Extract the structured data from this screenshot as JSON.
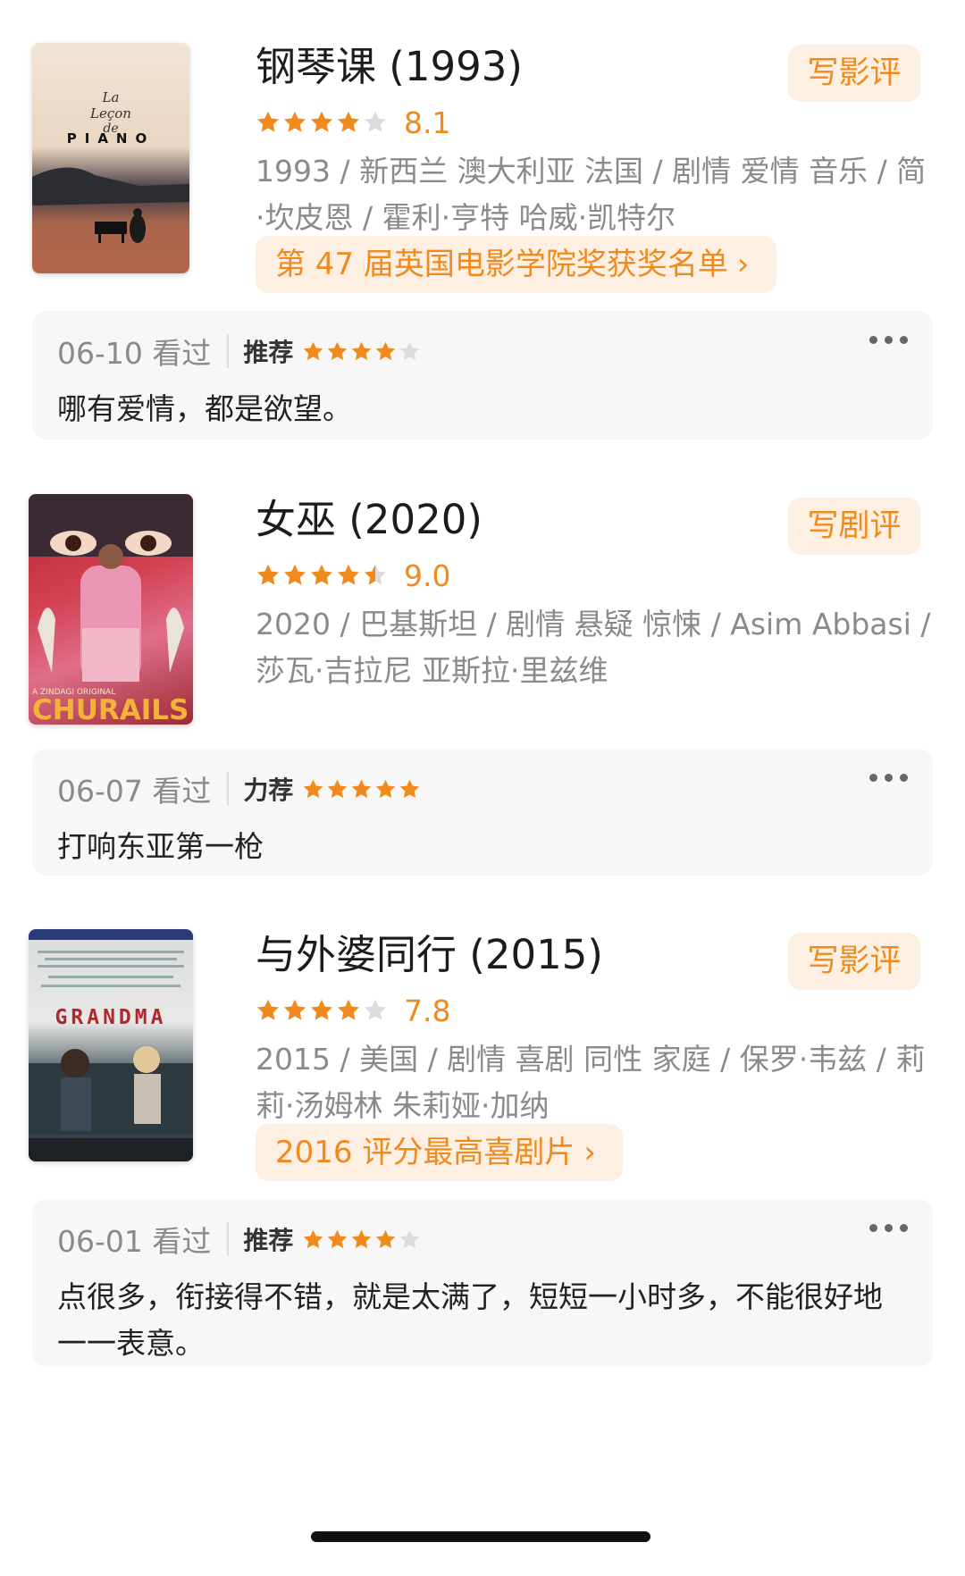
{
  "entries": [
    {
      "title": "钢琴课 (1993)",
      "write_button": "写影评",
      "rating_stars": 4,
      "score": "8.1",
      "meta": "1993 / 新西兰 澳大利亚 法国 / 剧情 爱情 音乐 / 简·坎皮恩 / 霍利·亨特 哈威·凯特尔",
      "award": "第 47 届英国电影学院奖获奖名单",
      "poster": {
        "texts": [
          "La",
          "Leçon",
          "de",
          "PIANO"
        ]
      },
      "review": {
        "date": "06-10 看过",
        "recommend": "推荐",
        "stars": 4,
        "text": "哪有爱情，都是欲望。"
      }
    },
    {
      "title": "女巫 (2020)",
      "write_button": "写剧评",
      "rating_stars": 4.5,
      "score": "9.0",
      "meta": "2020 / 巴基斯坦 / 剧情 悬疑 惊悚 / Asim Abbasi / 莎瓦·吉拉尼 亚斯拉·里兹维",
      "award": "",
      "poster": {
        "texts": [
          "A ZINDAGI ORIGINAL",
          "CHURAILS"
        ]
      },
      "review": {
        "date": "06-07 看过",
        "recommend": "力荐",
        "stars": 5,
        "text": "打响东亚第一枪"
      }
    },
    {
      "title": "与外婆同行 (2015)",
      "write_button": "写影评",
      "rating_stars": 4,
      "score": "7.8",
      "meta": "2015 / 美国 / 剧情 喜剧 同性 家庭 / 保罗·韦兹 / 莉莉·汤姆林 朱莉娅·加纳",
      "award": "2016 评分最高喜剧片",
      "poster": {
        "texts": [
          "GRANDMA"
        ]
      },
      "review": {
        "date": "06-01 看过",
        "recommend": "推荐",
        "stars": 4,
        "text": "点很多，衔接得不错，就是太满了，短短一小时多，不能很好地一一表意。"
      }
    }
  ],
  "colors": {
    "accent": "#f08a1c",
    "accent_bg": "#fdf0e3",
    "star_off": "#dcdcdc",
    "review_bg": "#f7f7f7"
  },
  "award_chevron": "›"
}
